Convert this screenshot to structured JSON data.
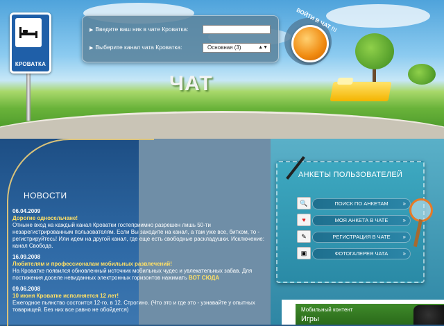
{
  "sign": {
    "label": "КРОВАТКА"
  },
  "login": {
    "name_label": "Введите ваш ник в чате Кроватка:",
    "channel_label": "Выберите канал чата Кроватка:",
    "channel_selected": "Основная (3)",
    "enter_label": "ВОЙТИ В ЧАТ !!!"
  },
  "hero": {
    "title": "ЧАТ"
  },
  "news": {
    "heading": "НОВОСТИ",
    "items": [
      {
        "date": "06.04.2009",
        "title": "Дорогие односельчане!",
        "body": "Отныне вход на каждый канал Кроватки гостеприимно разрешен лишь 50-ти незарегистрированным пользователям. Если Вы заходите на канал, а там уже все, битком, то - регистрируйтесь! Или идем на другой канал, где еще есть свободные раскладушки. Исключение: канал Свобода."
      },
      {
        "date": "16.09.2008",
        "title": "Любителям и профессионалам мобильных развлечений!",
        "body": "На Кроватке появился обновленный источник мобильных чудес и увлекательных забав. Для постижения доселе невиданных электронных горизонтов нажимать",
        "link": "ВОТ СЮДА"
      },
      {
        "date": "09.06.2008",
        "title": "10 июня Кроватке исполняется 12 лет!",
        "body": "Ежегодное пьянство состоится 12-го, в 12. Строгино. (Что это и где это - узнавайте у опытных товарищей. Без них все равно не обойдется)"
      }
    ]
  },
  "profiles": {
    "title": "АНКЕТЫ ПОЛЬЗОВАТЕЛЕЙ",
    "items": [
      {
        "label": "ПОИСК ПО АНКЕТАМ",
        "icon": "search-icon"
      },
      {
        "label": "МОЯ АНКЕТА В ЧАТЕ",
        "icon": "heart-icon"
      },
      {
        "label": "РЕГИСТРАЦИЯ В ЧАТЕ",
        "icon": "form-icon"
      },
      {
        "label": "ФОТОГАЛЕРЕЯ ЧАТА",
        "icon": "photo-icon"
      }
    ]
  },
  "mobile": {
    "label": "Мобильный контент",
    "title": "Игры"
  },
  "colors": {
    "accent": "#f08a10",
    "news_title": "#ffe066",
    "card": "#3da8c0"
  }
}
